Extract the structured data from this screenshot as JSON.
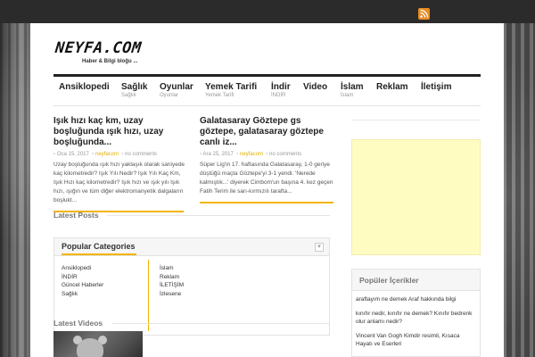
{
  "site": {
    "logo": "NEYFA.COM",
    "tagline": "Haber & Bilgi bloğu ..."
  },
  "colors": {
    "accent": "#f4b400",
    "topbar": "#2b2b2b",
    "rss": "#e88c23",
    "ad_bg": "#fffcc2"
  },
  "nav": [
    {
      "label": "Ansiklopedi",
      "sub": ""
    },
    {
      "label": "Sağlık",
      "sub": "Sağlık"
    },
    {
      "label": "Oyunlar",
      "sub": "Oyunlar"
    },
    {
      "label": "Yemek Tarifi",
      "sub": "Yemek Tarifi"
    },
    {
      "label": "İndir",
      "sub": "İNDİR"
    },
    {
      "label": "Video",
      "sub": ""
    },
    {
      "label": "İslam",
      "sub": "İslam"
    },
    {
      "label": "Reklam",
      "sub": ""
    },
    {
      "label": "İletişim",
      "sub": ""
    }
  ],
  "posts": [
    {
      "title": "Işık hızı kaç km, uzay boşluğunda ışık hızı, uzay boşluğunda...",
      "date": "Oca 15, 2017",
      "author": "neyfacom",
      "comments": "no comments",
      "excerpt": "Uzay boşluğunda ışık hızı yaklaşık olarak saniyede kaç kilometredir? Işık Yılı Nedir? Işık Yılı Kaç Km, Işık Hızı kaç kilometredir? Işık hızı ve ışık yılı Işık hızı, ışığın ve tüm diğer elektromanyetik dalgaların boşlukt..."
    },
    {
      "title": "Galatasaray Göztepe gs göztepe, galatasaray göztepe canlı iz...",
      "date": "Ara 25, 2017",
      "author": "neyfacom",
      "comments": "no comments",
      "excerpt": "Süper Lig'in 17. haftasında Galatasaray, 1-0 geriye düştüğü maçta Göztepe'yi 3-1 yendi. 'Nerede kalmıştık...' diyerek Cimbom'un başına 4. kez geçen Fatih Terim ile sarı-kırmızılı tarafta..."
    }
  ],
  "sections": {
    "latest_posts": "Latest Posts",
    "latest_videos": "Latest Videos"
  },
  "popular_categories": {
    "title": "Popular Categories",
    "toggle": "▾",
    "left": [
      "Ansiklopedi",
      "İNDİR",
      "Güncel Haberler",
      "Sağlık"
    ],
    "right": [
      "İslam",
      "Reklam",
      "İLETİŞİM",
      "İzlesene"
    ]
  },
  "popular_posts": {
    "title": "Popüler İçerikler",
    "items": [
      "araftayım ne demek Araf hakkında bilgi",
      "kınıfır nedir, kınıfır ne demek? Kınıfır bedrenk olur anlamı nedir?",
      "Vincent Van Gogh Kimdir resimli, Kısaca Hayatı ve Eserleri"
    ]
  },
  "icons": {
    "rss": "rss-icon",
    "date": "calendar-icon",
    "author": "user-icon",
    "comments": "comment-icon"
  }
}
